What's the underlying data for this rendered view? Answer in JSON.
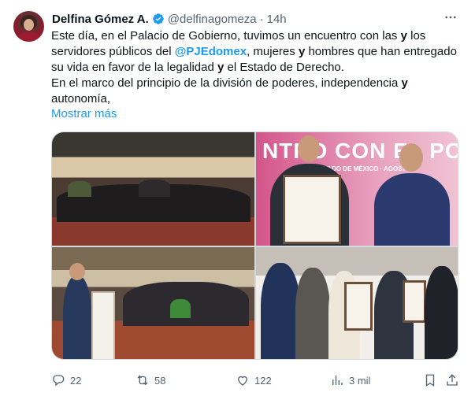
{
  "author": {
    "name": "Delfina Gómez A.",
    "handle": "@delfinagomeza",
    "separator": "·",
    "time": "14h"
  },
  "body": {
    "p1_part1": "Este día, en el Palacio de Gobierno, tuvimos un encuentro con las ",
    "p1_and1": "y",
    "p1_part2": " los servidores públicos del ",
    "p1_mention": "@PJEdomex",
    "p1_part3": ", mujeres ",
    "p1_and2": "y",
    "p1_part4": " hombres que han entregado su vida en favor de la legalidad ",
    "p1_and3": "y",
    "p1_part5": " el Estado de Derecho.",
    "p2_part1": "En el marco del principio de la división de poderes, independencia ",
    "p2_and": "y",
    "p2_part2": " autonomía,",
    "show_more": "Mostrar más"
  },
  "media": {
    "banner_text": "NTRO CON EL PO",
    "banner_sub": "TADO DE MÉXICO · AGOST"
  },
  "actions": {
    "replies": "22",
    "retweets": "58",
    "likes": "122",
    "views": "3 mil"
  },
  "colors": {
    "accent": "#1d9bf0",
    "text": "#0f1419",
    "muted": "#536471"
  }
}
